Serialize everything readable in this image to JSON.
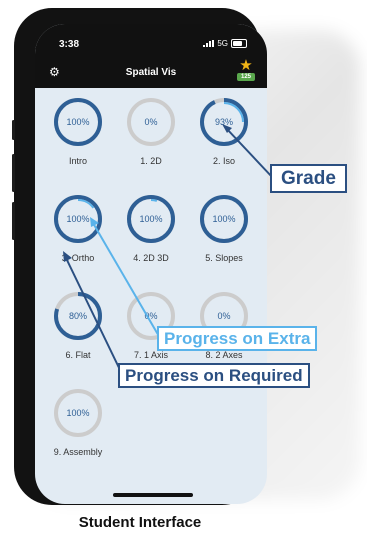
{
  "status_bar": {
    "time": "3:38",
    "network": "5G"
  },
  "header": {
    "title": "Spatial Vis",
    "settings_icon": "gear-icon",
    "star_icon": "star-icon",
    "score": "125"
  },
  "modules": [
    {
      "label": "Intro",
      "progress": "100%",
      "required_fraction": 1.0,
      "extra_fraction": 0
    },
    {
      "label": "1. 2D",
      "progress": "0%",
      "required_fraction": 0,
      "extra_fraction": 0
    },
    {
      "label": "2. Iso",
      "progress": "93%",
      "required_fraction": 0.93,
      "extra_fraction": 0.25
    },
    {
      "label": "3. Ortho",
      "progress": "100%",
      "required_fraction": 1.0,
      "extra_fraction": 0.15
    },
    {
      "label": "4. 2D 3D",
      "progress": "100%",
      "required_fraction": 1.0,
      "extra_fraction": 0.05
    },
    {
      "label": "5. Slopes",
      "progress": "100%",
      "required_fraction": 1.0,
      "extra_fraction": 0
    },
    {
      "label": "6. Flat",
      "progress": "80%",
      "required_fraction": 0.8,
      "extra_fraction": 0
    },
    {
      "label": "7. 1 Axis",
      "progress": "0%",
      "required_fraction": 0,
      "extra_fraction": 0
    },
    {
      "label": "8. 2 Axes",
      "progress": "0%",
      "required_fraction": 0,
      "extra_fraction": 0
    },
    {
      "label": "9. Assembly",
      "progress": "100%",
      "required_fraction": 0,
      "extra_fraction": 0
    }
  ],
  "annotations": {
    "grade": "Grade",
    "progress_extra": "Progress on Extra",
    "progress_required": "Progress on Required"
  },
  "caption": "Student Interface",
  "colors": {
    "required_ring": "#2e5f95",
    "extra_ring": "#5ab3ea",
    "track_ring": "#cccccc",
    "score_badge": "#5aa84d",
    "star": "#f2b516",
    "grade_callout": "#2b4f81",
    "extra_callout": "#5ab3ea",
    "required_callout": "#2b4f81"
  }
}
